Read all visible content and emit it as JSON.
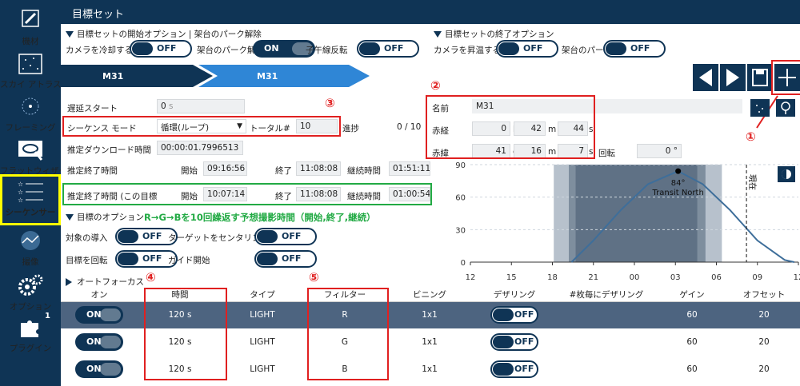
{
  "sidebar": {
    "items": [
      {
        "label": "機材",
        "icon": "telescope-icon"
      },
      {
        "label": "スカイ アトラス",
        "icon": "sky-atlas-icon"
      },
      {
        "label": "フレーミング",
        "icon": "framing-icon"
      },
      {
        "label": "フラットウィザード",
        "icon": "flat-wizard-icon"
      },
      {
        "label": "シーケンサー",
        "icon": "sequencer-icon"
      },
      {
        "label": "撮像",
        "icon": "imaging-icon"
      },
      {
        "label": "オプション",
        "icon": "gears-icon"
      },
      {
        "label": "プラグイン",
        "icon": "puzzle-icon",
        "badge": "1"
      }
    ]
  },
  "header": {
    "title": "目標セット"
  },
  "start_options": {
    "title": "目標セットの開始オプション",
    "extra": "| 架台のパーク解除",
    "cool_label": "カメラを冷却する",
    "cool_value": "OFF",
    "unpark_label": "架台のパーク解除",
    "unpark_value": "ON",
    "meridian_label": "子午線反転",
    "meridian_value": "OFF"
  },
  "end_options": {
    "title": "目標セットの終了オプション",
    "warm_label": "カメラを昇温する",
    "warm_value": "OFF",
    "park_label": "架台のパーク",
    "park_value": "OFF"
  },
  "targets": {
    "first": "M31",
    "second": "M31"
  },
  "settings": {
    "delay_label": "遅延スタート",
    "delay_value": "0",
    "delay_unit": "s",
    "mode_label": "シーケンス モード",
    "mode_value": "循環(ループ)",
    "total_label": "トータル#",
    "total_value": "10",
    "progress_label": "進捗",
    "progress_value": "0 / 10",
    "download_label": "推定ダウンロード時間",
    "download_value": "00:00:01.7996513",
    "est_end_label": "推定終了時間",
    "start_label": "開始",
    "end_label": "終了",
    "duration_label": "継続時間",
    "est_start_1": "09:16:56",
    "est_end_1": "11:08:08",
    "est_dur_1": "01:51:11",
    "est_end_label_2": "推定終了時間 (この目標",
    "est_start_2": "10:07:14",
    "est_end_2": "11:08:08",
    "est_dur_2": "01:00:54"
  },
  "annotation": {
    "note": "R→G→Bを10回繰返す予想撮影時間（開始,終了,継続）"
  },
  "target_options": {
    "title": "目標のオプション",
    "slew_label": "対象の導入",
    "slew_value": "OFF",
    "center_label": "ターゲットをセンタリング",
    "center_value": "OFF",
    "rotate_label": "目標を回転",
    "rotate_value": "OFF",
    "guide_label": "ガイド開始",
    "guide_value": "OFF"
  },
  "autofocus": {
    "title": "オートフォーカス"
  },
  "coords": {
    "name_label": "名前",
    "name_value": "M31",
    "ra_label": "赤経",
    "ra_h": "0",
    "ra_h_unit": "h",
    "ra_m": "42",
    "ra_m_unit": "m",
    "ra_s": "44",
    "ra_s_unit": "s",
    "dec_label": "赤緯",
    "dec_d": "41",
    "dec_d_unit": "d",
    "dec_m": "16",
    "dec_m_unit": "m",
    "dec_s": "7",
    "dec_s_unit": "s",
    "rot_label": "回転",
    "rot_value": "0 °"
  },
  "markers": {
    "m1": "①",
    "m2": "②",
    "m3": "③",
    "m4": "④",
    "m5": "⑤"
  },
  "chart_data": {
    "type": "line",
    "yticks": [
      "90",
      "60",
      "30",
      "0"
    ],
    "ylim": [
      0,
      90
    ],
    "xticks": [
      "12",
      "15",
      "18",
      "21",
      "00",
      "03",
      "06",
      "09",
      "12"
    ],
    "transit_label": "84°",
    "transit_name": "Transit North",
    "now_label": "現在",
    "series": [
      {
        "x": [
          19.4,
          21,
          23,
          1,
          3.2,
          5,
          7,
          9,
          11,
          11.7
        ],
        "y": [
          0,
          20,
          48,
          72,
          84,
          72,
          48,
          20,
          2,
          0
        ]
      }
    ]
  },
  "table": {
    "headers": [
      "オン",
      "時間",
      "タイプ",
      "フィルター",
      "ビニング",
      "デザリング",
      "#枚毎にデザリング",
      "ゲイン",
      "オフセット"
    ],
    "rows": [
      {
        "on": "ON",
        "time": "120 s",
        "type": "LIGHT",
        "filter": "R",
        "binning": "1x1",
        "dither": "OFF",
        "dither_every": "",
        "gain": "60",
        "offset": "20"
      },
      {
        "on": "ON",
        "time": "120 s",
        "type": "LIGHT",
        "filter": "G",
        "binning": "1x1",
        "dither": "OFF",
        "dither_every": "",
        "gain": "60",
        "offset": "20"
      },
      {
        "on": "ON",
        "time": "120 s",
        "type": "LIGHT",
        "filter": "B",
        "binning": "1x1",
        "dither": "OFF",
        "dither_every": "",
        "gain": "60",
        "offset": "20"
      }
    ]
  }
}
